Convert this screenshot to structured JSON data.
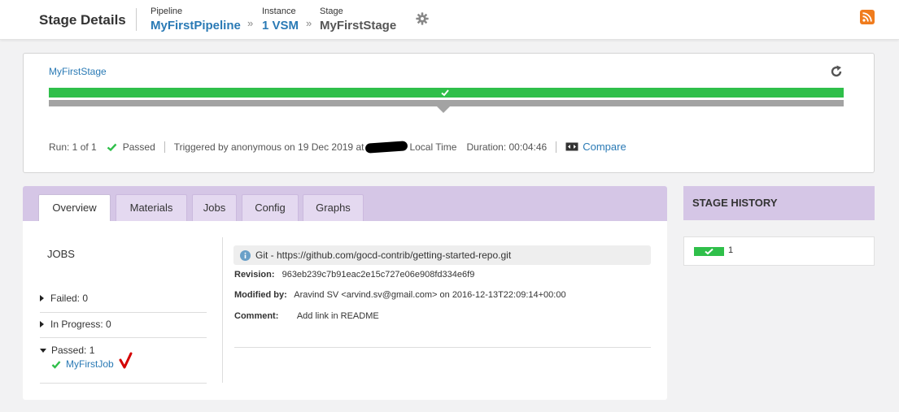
{
  "header": {
    "title": "Stage Details",
    "pipeline": {
      "label": "Pipeline",
      "value": "MyFirstPipeline"
    },
    "instance": {
      "label": "Instance",
      "value": "1 VSM"
    },
    "stage": {
      "label": "Stage",
      "value": "MyFirstStage"
    },
    "separator": "»"
  },
  "summary": {
    "stage_name": "MyFirstStage",
    "run": "Run: 1 of 1",
    "status": "Passed",
    "triggered_prefix": "Triggered by anonymous on 19 Dec 2019 at",
    "triggered_suffix": "Local Time",
    "duration": "Duration: 00:04:46",
    "compare": "Compare"
  },
  "tabs": [
    {
      "label": "Overview"
    },
    {
      "label": "Materials"
    },
    {
      "label": "Jobs"
    },
    {
      "label": "Config"
    },
    {
      "label": "Graphs"
    }
  ],
  "jobs": {
    "title": "JOBS",
    "failed": "Failed: 0",
    "in_progress": "In Progress: 0",
    "passed": "Passed: 1",
    "passed_jobs": [
      "MyFirstJob"
    ]
  },
  "material": {
    "git": "Git - https://github.com/gocd-contrib/getting-started-repo.git",
    "revision_label": "Revision:",
    "revision": "963eb239c7b91eac2e15c727e06e908fd334e6f9",
    "modified_label": "Modified by:",
    "modified": "Aravind SV <arvind.sv@gmail.com> on 2016-12-13T22:09:14+00:00",
    "comment_label": "Comment:",
    "comment": "Add link in README"
  },
  "history": {
    "title": "STAGE HISTORY",
    "entries": [
      {
        "label": "1",
        "status": "passed"
      }
    ]
  },
  "colors": {
    "accent_link": "#2a7ab5",
    "passed_green": "#2fbf4a",
    "tab_purple": "#d5c6e6",
    "rss_orange": "#f07c1d"
  }
}
